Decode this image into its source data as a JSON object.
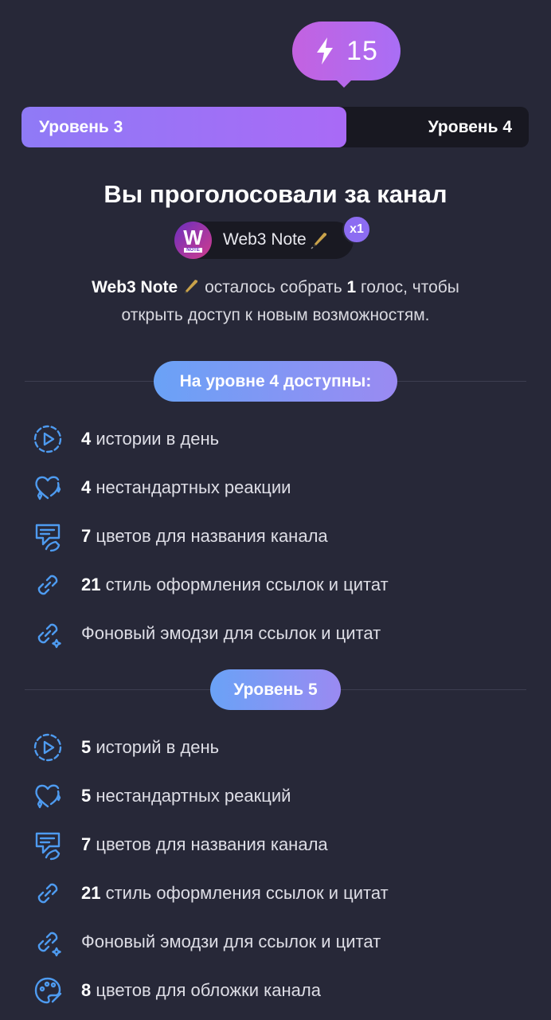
{
  "boost": {
    "count": "15",
    "icon": "lightning-icon"
  },
  "levels": {
    "current": "Уровень 3",
    "next": "Уровень 4",
    "progress": 0.64
  },
  "title": "Вы проголосовали за канал",
  "channel": {
    "name": "Web3 Note",
    "avatar_letter": "W",
    "avatar_sub": "NOTE",
    "multiplier": "x1"
  },
  "description": {
    "channel": "Web3 Note",
    "part1": " осталось собрать ",
    "count": "1",
    "part2": " голос, чтобы",
    "line2": "открыть доступ к новым возможностям."
  },
  "section1": {
    "title": "На уровне 4 доступны:",
    "features": [
      {
        "icon": "stories-icon",
        "num": "4",
        "text": " истории в день"
      },
      {
        "icon": "heart-reaction-icon",
        "num": "4",
        "text": " нестандартных реакции"
      },
      {
        "icon": "name-color-icon",
        "num": "7",
        "text": " цветов для названия канала"
      },
      {
        "icon": "link-style-icon",
        "num": "21",
        "text": " стиль оформления ссылок и цитат"
      },
      {
        "icon": "link-emoji-icon",
        "num": "",
        "text": "Фоновый эмодзи для ссылок и цитат"
      }
    ]
  },
  "section2": {
    "title": "Уровень 5",
    "features": [
      {
        "icon": "stories-icon",
        "num": "5",
        "text": " историй в день"
      },
      {
        "icon": "heart-reaction-icon",
        "num": "5",
        "text": " нестандартных реакций"
      },
      {
        "icon": "name-color-icon",
        "num": "7",
        "text": " цветов для названия канала"
      },
      {
        "icon": "link-style-icon",
        "num": "21",
        "text": " стиль оформления ссылок и цитат"
      },
      {
        "icon": "link-emoji-icon",
        "num": "",
        "text": "Фоновый эмодзи для ссылок и цитат"
      },
      {
        "icon": "palette-icon",
        "num": "8",
        "text": " цветов для обложки канала"
      }
    ]
  },
  "colors": {
    "background": "#272838",
    "accent_blue": "#4e9bf0",
    "accent_purple": "#a96af6"
  }
}
